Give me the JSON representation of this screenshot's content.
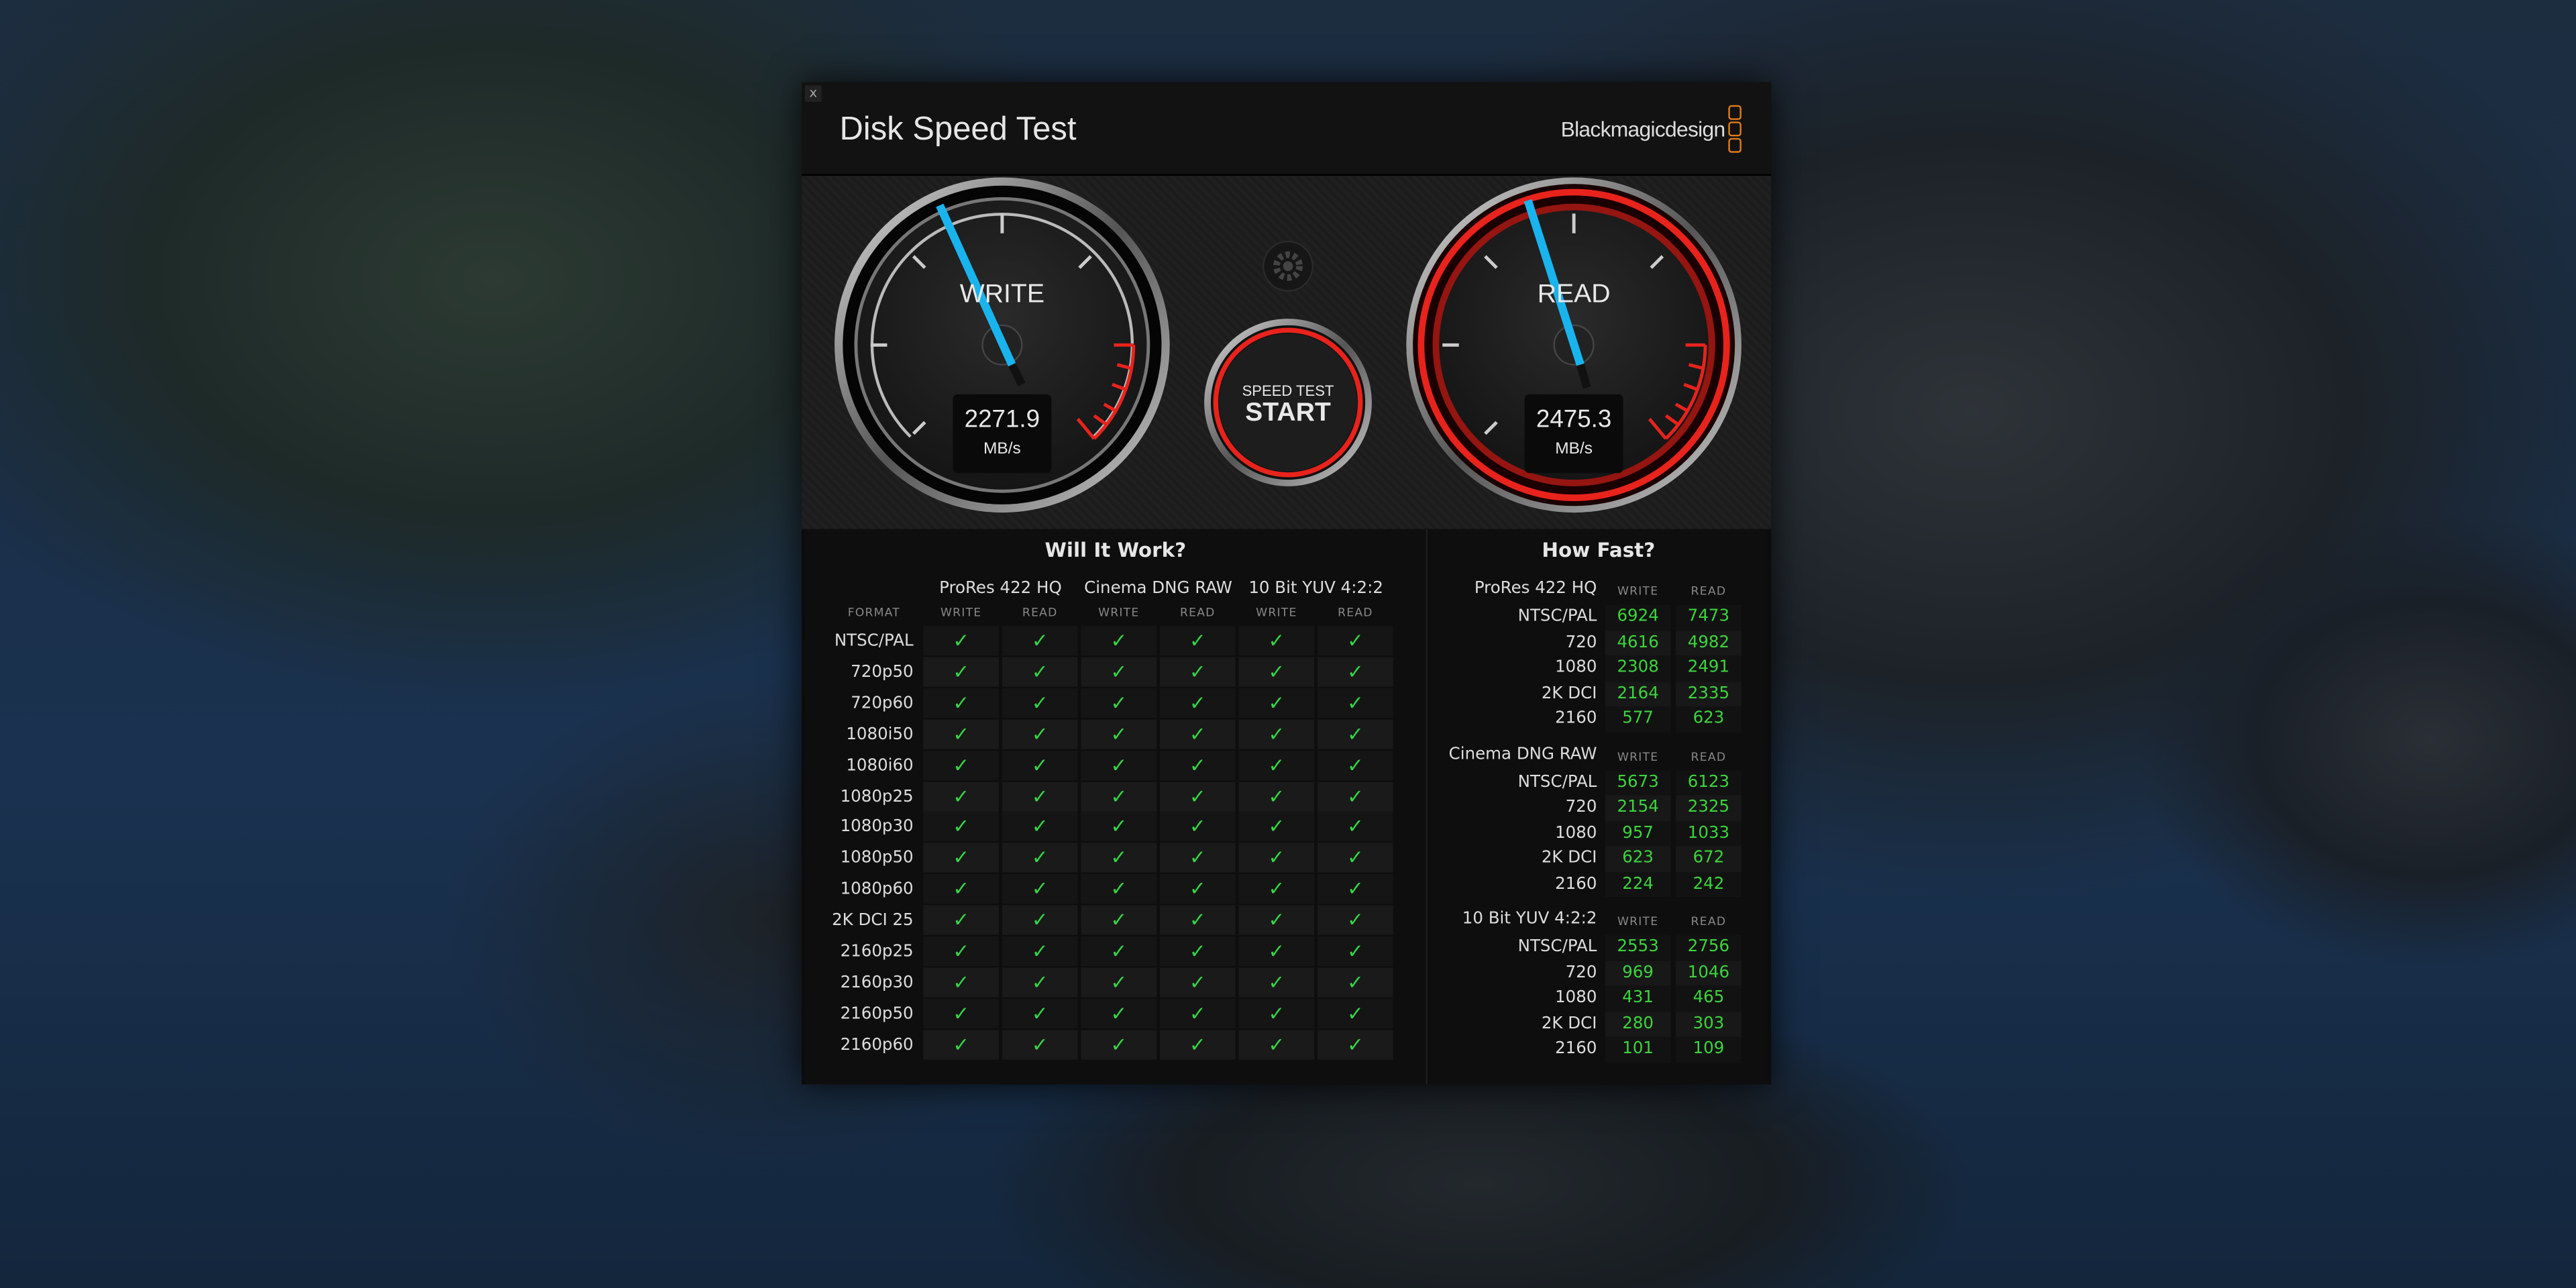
{
  "window": {
    "title": "Disk Speed Test",
    "brand": "Blackmagicdesign",
    "close_label": "x"
  },
  "gauges": {
    "write": {
      "label": "WRITE",
      "value": "2271.9",
      "unit": "MB/s"
    },
    "read": {
      "label": "READ",
      "value": "2475.3",
      "unit": "MB/s"
    },
    "start_button": {
      "line1": "SPEED TEST",
      "line2": "START"
    }
  },
  "will_it_work": {
    "title": "Will It Work?",
    "format_label": "FORMAT",
    "codecs": [
      "ProRes 422 HQ",
      "Cinema DNG RAW",
      "10 Bit YUV 4:2:2"
    ],
    "sub_headers": [
      "WRITE",
      "READ"
    ],
    "check_symbol": "✓",
    "formats": [
      "NTSC/PAL",
      "720p50",
      "720p60",
      "1080i50",
      "1080i60",
      "1080p25",
      "1080p30",
      "1080p50",
      "1080p60",
      "2K DCI 25",
      "2160p25",
      "2160p30",
      "2160p50",
      "2160p60"
    ]
  },
  "how_fast": {
    "title": "How Fast?",
    "sub_headers": [
      "WRITE",
      "READ"
    ],
    "groups": [
      {
        "name": "ProRes 422 HQ",
        "rows": [
          [
            "NTSC/PAL",
            "6924",
            "7473"
          ],
          [
            "720",
            "4616",
            "4982"
          ],
          [
            "1080",
            "2308",
            "2491"
          ],
          [
            "2K DCI",
            "2164",
            "2335"
          ],
          [
            "2160",
            "577",
            "623"
          ]
        ]
      },
      {
        "name": "Cinema DNG RAW",
        "rows": [
          [
            "NTSC/PAL",
            "5673",
            "6123"
          ],
          [
            "720",
            "2154",
            "2325"
          ],
          [
            "1080",
            "957",
            "1033"
          ],
          [
            "2K DCI",
            "623",
            "672"
          ],
          [
            "2160",
            "224",
            "242"
          ]
        ]
      },
      {
        "name": "10 Bit YUV 4:2:2",
        "rows": [
          [
            "NTSC/PAL",
            "2553",
            "2756"
          ],
          [
            "720",
            "969",
            "1046"
          ],
          [
            "1080",
            "431",
            "465"
          ],
          [
            "2K DCI",
            "280",
            "303"
          ],
          [
            "2160",
            "101",
            "109"
          ]
        ]
      }
    ]
  },
  "colors": {
    "accent_red": "#e8231c",
    "needle": "#19b4ee",
    "value_green": "#3cd43c",
    "logo_orange": "#e07b1a"
  }
}
